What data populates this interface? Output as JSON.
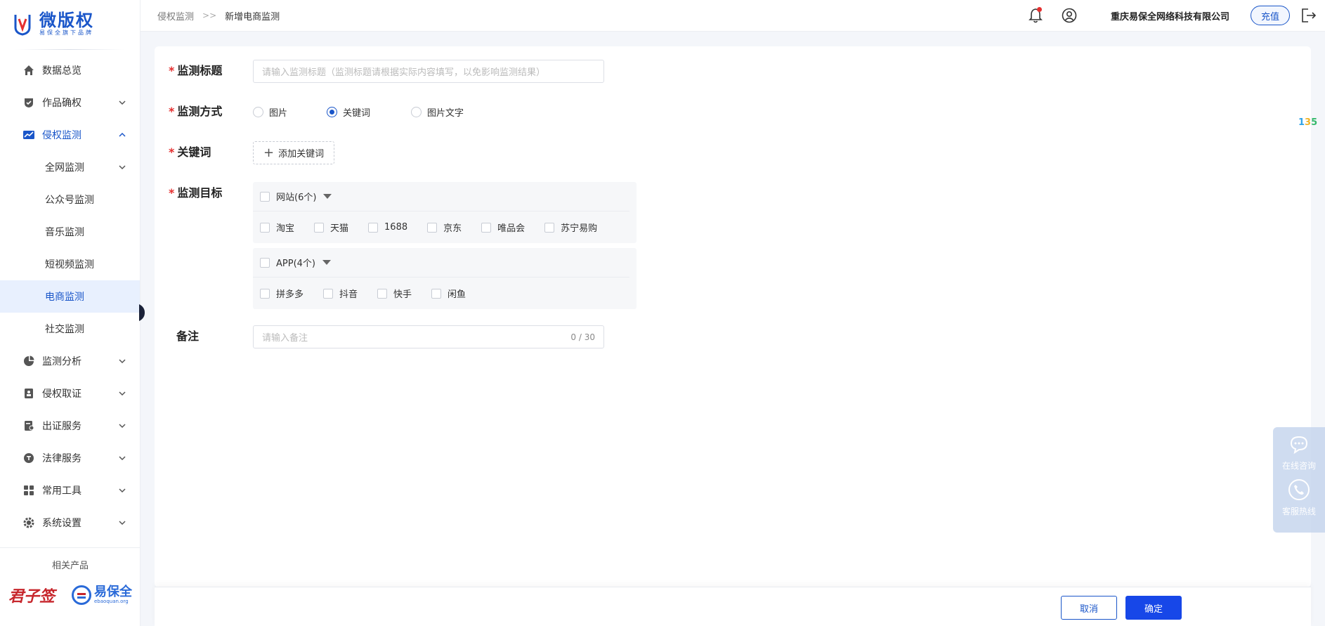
{
  "brand": {
    "name": "微版权",
    "subtitle": "易保全旗下品牌"
  },
  "sidebar": {
    "menu": [
      {
        "label": "数据总览",
        "icon": "home-icon",
        "expandable": false
      },
      {
        "label": "作品确权",
        "icon": "verify-icon",
        "expandable": true
      },
      {
        "label": "侵权监测",
        "icon": "trend-icon",
        "expandable": true,
        "expanded": true
      }
    ],
    "submenu": [
      {
        "label": "全网监测",
        "expandable": true
      },
      {
        "label": "公众号监测"
      },
      {
        "label": "音乐监测"
      },
      {
        "label": "短视频监测"
      },
      {
        "label": "电商监测",
        "selected": true
      },
      {
        "label": "社交监测"
      }
    ],
    "menu_after": [
      {
        "label": "监测分析",
        "icon": "pie-icon"
      },
      {
        "label": "侵权取证",
        "icon": "evidence-icon"
      },
      {
        "label": "出证服务",
        "icon": "certificate-icon"
      },
      {
        "label": "法律服务",
        "icon": "law-icon"
      },
      {
        "label": "常用工具",
        "icon": "tools-icon"
      },
      {
        "label": "系统设置",
        "icon": "gear-icon"
      }
    ],
    "related_title": "相关产品",
    "partners": {
      "junzi": "君子签",
      "ebq_name": "易保全",
      "ebq_url": "ebaoquan.org"
    }
  },
  "header": {
    "breadcrumb_parent": "侵权监测",
    "breadcrumb_sep": ">>",
    "breadcrumb_current": "新增电商监测",
    "company": "重庆易保全网络科技有限公司",
    "recharge": "充值"
  },
  "form": {
    "title_label": "监测标题",
    "title_placeholder": "请输入监测标题（监测标题请根据实际内容填写，以免影响监测结果）",
    "mode_label": "监测方式",
    "mode_options": [
      "图片",
      "关键词",
      "图片文字"
    ],
    "mode_selected": "关键词",
    "keyword_label": "关键词",
    "add_keyword": "添加关键词",
    "target_label": "监测目标",
    "site_group": "网站(6个)",
    "sites": [
      "淘宝",
      "天猫",
      "1688",
      "京东",
      "唯品会",
      "苏宁易购"
    ],
    "app_group": "APP(4个)",
    "apps": [
      "拼多多",
      "抖音",
      "快手",
      "闲鱼"
    ],
    "remark_label": "备注",
    "remark_placeholder": "请输入备注",
    "remark_count": "0 / 30"
  },
  "footer": {
    "cancel": "取消",
    "confirm": "确定"
  },
  "floating": {
    "badge_135": [
      "1",
      "3",
      "5"
    ],
    "online_consult": "在线咨询",
    "hotline": "客服热线"
  },
  "colors": {
    "accent": "#1a56c9",
    "primary_button": "#1747e8",
    "required": "#e52f2f"
  }
}
